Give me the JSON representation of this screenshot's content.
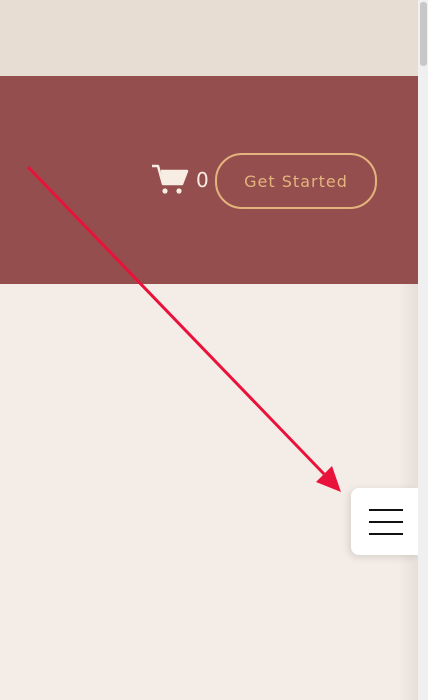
{
  "header": {
    "cart": {
      "icon": "cart-icon",
      "count": "0"
    },
    "cta_label": "Get Started"
  },
  "menu": {
    "icon": "hamburger-menu-icon"
  },
  "colors": {
    "header_bg": "#944e4d",
    "page_bg": "#f4ece6",
    "top_band": "#e8ddd2",
    "accent": "#e4b47e",
    "cart": "#f7ede3",
    "arrow": "#e8123a"
  }
}
